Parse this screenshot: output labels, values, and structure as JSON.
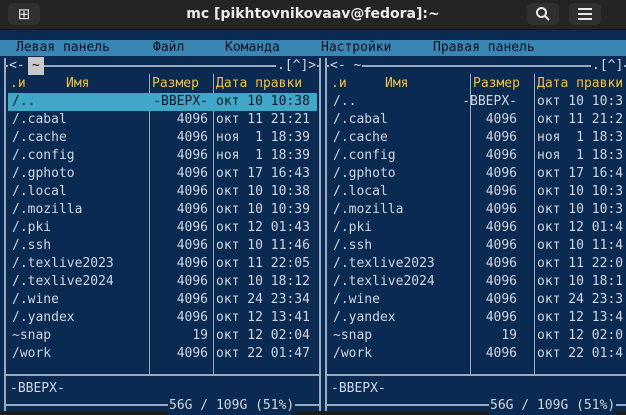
{
  "window": {
    "title": "mc [pikhtovnikovaav@fedora]:~",
    "new_tab_icon": "plus-square-icon",
    "search_icon": "search-icon",
    "menu_icon": "hamburger-menu-icon"
  },
  "menubar": {
    "items": [
      "Левая панель",
      "Файл",
      "Команда",
      "Настройки",
      "Правая панель"
    ]
  },
  "left_panel": {
    "top_left": "<- ",
    "path": "~",
    "top_right": ".[^]>",
    "columns": {
      "sort": ".и",
      "name": "Имя",
      "size": "Размер",
      "date": "Дата правки"
    },
    "rows": [
      {
        "name": "/..",
        "size": "-ВВЕРХ-",
        "date": "окт 10 10:38"
      },
      {
        "name": "/.cabal",
        "size": "4096",
        "date": "окт 11 21:21"
      },
      {
        "name": "/.cache",
        "size": "4096",
        "date": "ноя  1 18:39"
      },
      {
        "name": "/.config",
        "size": "4096",
        "date": "ноя  1 18:39"
      },
      {
        "name": "/.gphoto",
        "size": "4096",
        "date": "окт 17 16:43"
      },
      {
        "name": "/.local",
        "size": "4096",
        "date": "окт 10 10:38"
      },
      {
        "name": "/.mozilla",
        "size": "4096",
        "date": "окт 10 10:39"
      },
      {
        "name": "/.pki",
        "size": "4096",
        "date": "окт 12 01:43"
      },
      {
        "name": "/.ssh",
        "size": "4096",
        "date": "окт 10 11:46"
      },
      {
        "name": "/.texlive2023",
        "size": "4096",
        "date": "окт 11 22:05"
      },
      {
        "name": "/.texlive2024",
        "size": "4096",
        "date": "окт 10 18:12"
      },
      {
        "name": "/.wine",
        "size": "4096",
        "date": "окт 24 23:34"
      },
      {
        "name": "/.yandex",
        "size": "4096",
        "date": "окт 12 13:41"
      },
      {
        "name": "~snap",
        "size": "19",
        "date": "окт 12 02:04"
      },
      {
        "name": "/work",
        "size": "4096",
        "date": "окт 22 01:47"
      }
    ],
    "status": "-ВВЕРХ-",
    "disk": "56G / 109G (51%)"
  },
  "right_panel": {
    "top_left": "<- ~",
    "top_right": ".[^]",
    "columns": {
      "sort": ".и",
      "name": "Имя",
      "size": "Размер",
      "date": "Дата правки"
    },
    "rows": [
      {
        "name": "/..",
        "size": "-ВВЕРХ-",
        "date": "окт 10 10:3"
      },
      {
        "name": "/.cabal",
        "size": "4096",
        "date": "окт 11 21:2"
      },
      {
        "name": "/.cache",
        "size": "4096",
        "date": "ноя  1 18:3"
      },
      {
        "name": "/.config",
        "size": "4096",
        "date": "ноя  1 18:3"
      },
      {
        "name": "/.gphoto",
        "size": "4096",
        "date": "окт 17 16:4"
      },
      {
        "name": "/.local",
        "size": "4096",
        "date": "окт 10 10:3"
      },
      {
        "name": "/.mozilla",
        "size": "4096",
        "date": "окт 10 10:3"
      },
      {
        "name": "/.pki",
        "size": "4096",
        "date": "окт 12 01:4"
      },
      {
        "name": "/.ssh",
        "size": "4096",
        "date": "окт 10 11:4"
      },
      {
        "name": "/.texlive2023",
        "size": "4096",
        "date": "окт 11 22:0"
      },
      {
        "name": "/.texlive2024",
        "size": "4096",
        "date": "окт 10 18:1"
      },
      {
        "name": "/.wine",
        "size": "4096",
        "date": "окт 24 23:3"
      },
      {
        "name": "/.yandex",
        "size": "4096",
        "date": "окт 12 13:4"
      },
      {
        "name": "~snap",
        "size": "19",
        "date": "окт 12 02:0"
      },
      {
        "name": "/work",
        "size": "4096",
        "date": "окт 22 01:4"
      }
    ],
    "status": "-ВВЕРХ-",
    "disk": "56G / 109G (51%)"
  }
}
